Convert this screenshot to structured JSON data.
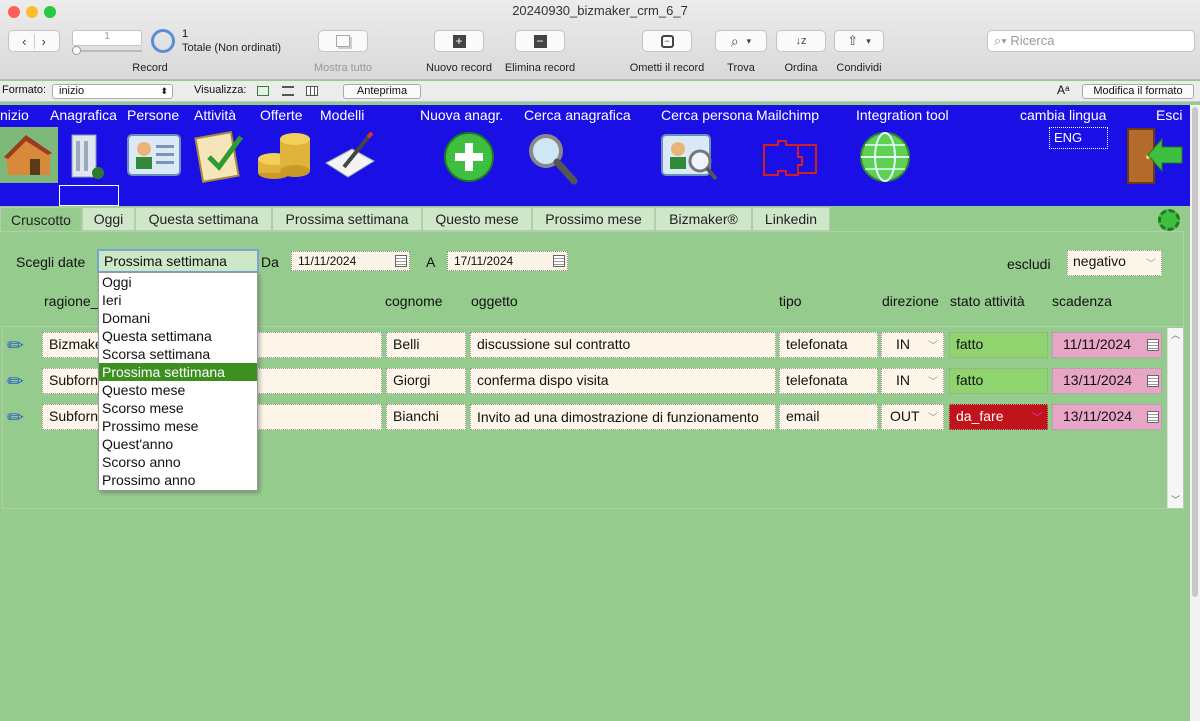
{
  "window": {
    "title": "20240930_bizmaker_crm_6_7"
  },
  "toolbar": {
    "record_value": "1",
    "record_count": "1",
    "record_total": "Totale (Non ordinati)",
    "record_label": "Record",
    "show_all": "Mostra tutto",
    "new_record": "Nuovo record",
    "delete_record": "Elimina record",
    "omit_record": "Ometti il record",
    "find": "Trova",
    "sort": "Ordina",
    "share": "Condividi",
    "search_placeholder": "Ricerca"
  },
  "formatbar": {
    "format_label": "Formato:",
    "format_value": "inizio",
    "view_label": "Visualizza:",
    "preview": "Anteprima",
    "edit_layout": "Modifica il formato"
  },
  "header": {
    "items": [
      "nizio",
      "Anagrafica",
      "Persone",
      "Attività",
      "Offerte",
      "Modelli",
      "Nuova anagr.",
      "Cerca anagrafica",
      "Cerca persona",
      "Mailchimp",
      "Integration tool",
      "cambia lingua",
      "Esci"
    ],
    "lang": "ENG"
  },
  "tabs": [
    "Cruscotto",
    "Oggi",
    "Questa settimana",
    "Prossima settimana",
    "Questo mese",
    "Prossimo mese",
    "Bizmaker®",
    "Linkedin"
  ],
  "filter": {
    "choose_label": "Scegli date",
    "choose_value": "Prossima settimana",
    "from_label": "Da",
    "from_date": "11/11/2024",
    "to_label": "A",
    "to_date": "17/11/2024",
    "exclude_label": "escludi",
    "exclude_value": "negativo"
  },
  "dropdown": {
    "options": [
      "Oggi",
      "Ieri",
      "Domani",
      "Questa settimana",
      "Scorsa settimana",
      "Prossima settimana",
      "Questo mese",
      "Scorso mese",
      "Prossimo mese",
      "Quest'anno",
      "Scorso anno",
      "Prossimo anno"
    ],
    "selected": "Prossima settimana"
  },
  "columns": {
    "ragione": "ragione_",
    "cognome": "cognome",
    "oggetto": "oggetto",
    "tipo": "tipo",
    "direzione": "direzione",
    "stato": "stato attività",
    "scadenza": "scadenza"
  },
  "rows": [
    {
      "ragione": "Bizmake",
      "cognome": "Belli",
      "oggetto": "discussione sul contratto",
      "tipo": "telefonata",
      "direzione": "IN",
      "stato": "fatto",
      "scadenza": "11/11/2024"
    },
    {
      "ragione": "Subforni",
      "cognome": "Giorgi",
      "oggetto": "conferma dispo visita",
      "tipo": "telefonata",
      "direzione": "IN",
      "stato": "fatto",
      "scadenza": "13/11/2024"
    },
    {
      "ragione": "Subforni",
      "cognome": "Bianchi",
      "oggetto": "Invito ad una dimostrazione di funzionamento della nuova macchina",
      "tipo": "email",
      "direzione": "OUT",
      "stato": "da_fare",
      "scadenza": "13/11/2024"
    }
  ],
  "colors": {
    "header_blue": "#1a10e6",
    "background_green": "#96cb8e",
    "stato_fatto": "#8fd46f",
    "stato_da_fare": "#c0141a",
    "scadenza_pink": "#e8a6c6",
    "selected_option": "#3d8f1f"
  }
}
